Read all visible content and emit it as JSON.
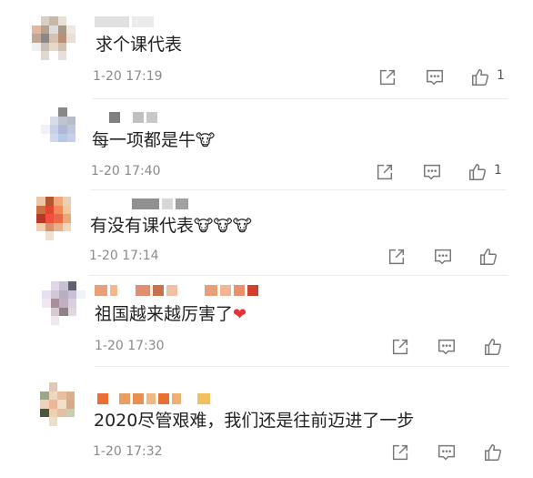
{
  "comments": [
    {
      "text": "求个课代表",
      "time": "1-20 17:19",
      "likes": "1"
    },
    {
      "text": "每一项都是牛",
      "emoji": "🐮",
      "time": "1-20 17:40",
      "likes": "1"
    },
    {
      "text": "有没有课代表",
      "emoji": "🐮🐮🐮",
      "time": "1-20 17:14",
      "likes": ""
    },
    {
      "text": "祖国越来越厉害了",
      "emoji": "❤",
      "time": "1-20 17:30",
      "likes": ""
    },
    {
      "text": "2020尽管艰难，我们还是往前迈进了一步",
      "time": "1-20 17:32",
      "likes": ""
    }
  ],
  "icons": {
    "share": "share-icon",
    "comment": "comment-icon",
    "like": "thumbs-up-icon"
  },
  "colors": {
    "text": "#222222",
    "time": "#8a8a8a",
    "icon": "#777777",
    "heart": "#e5333a"
  }
}
